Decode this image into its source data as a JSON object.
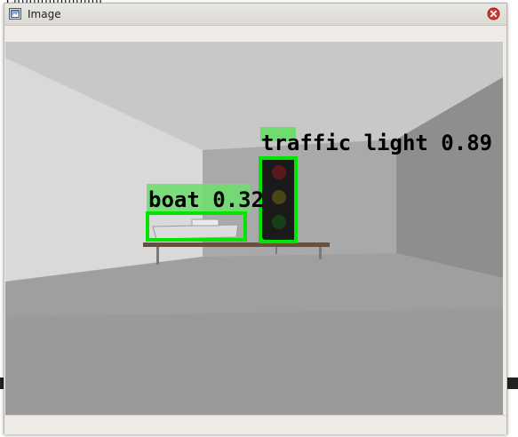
{
  "background": {
    "fragment_top": "Lulululululululu"
  },
  "window": {
    "title": "Image",
    "title_icon": "image-icon",
    "close_icon": "close-icon"
  },
  "detections": [
    {
      "label": "traffic light 0.89",
      "class": "traffic light",
      "score": 0.89
    },
    {
      "label": "boat 0.32",
      "class": "boat",
      "score": 0.32
    }
  ],
  "colors": {
    "box": "#00e600",
    "label_bg": "#6fdc6f",
    "label_text": "#000000",
    "close_red": "#d9342b"
  }
}
